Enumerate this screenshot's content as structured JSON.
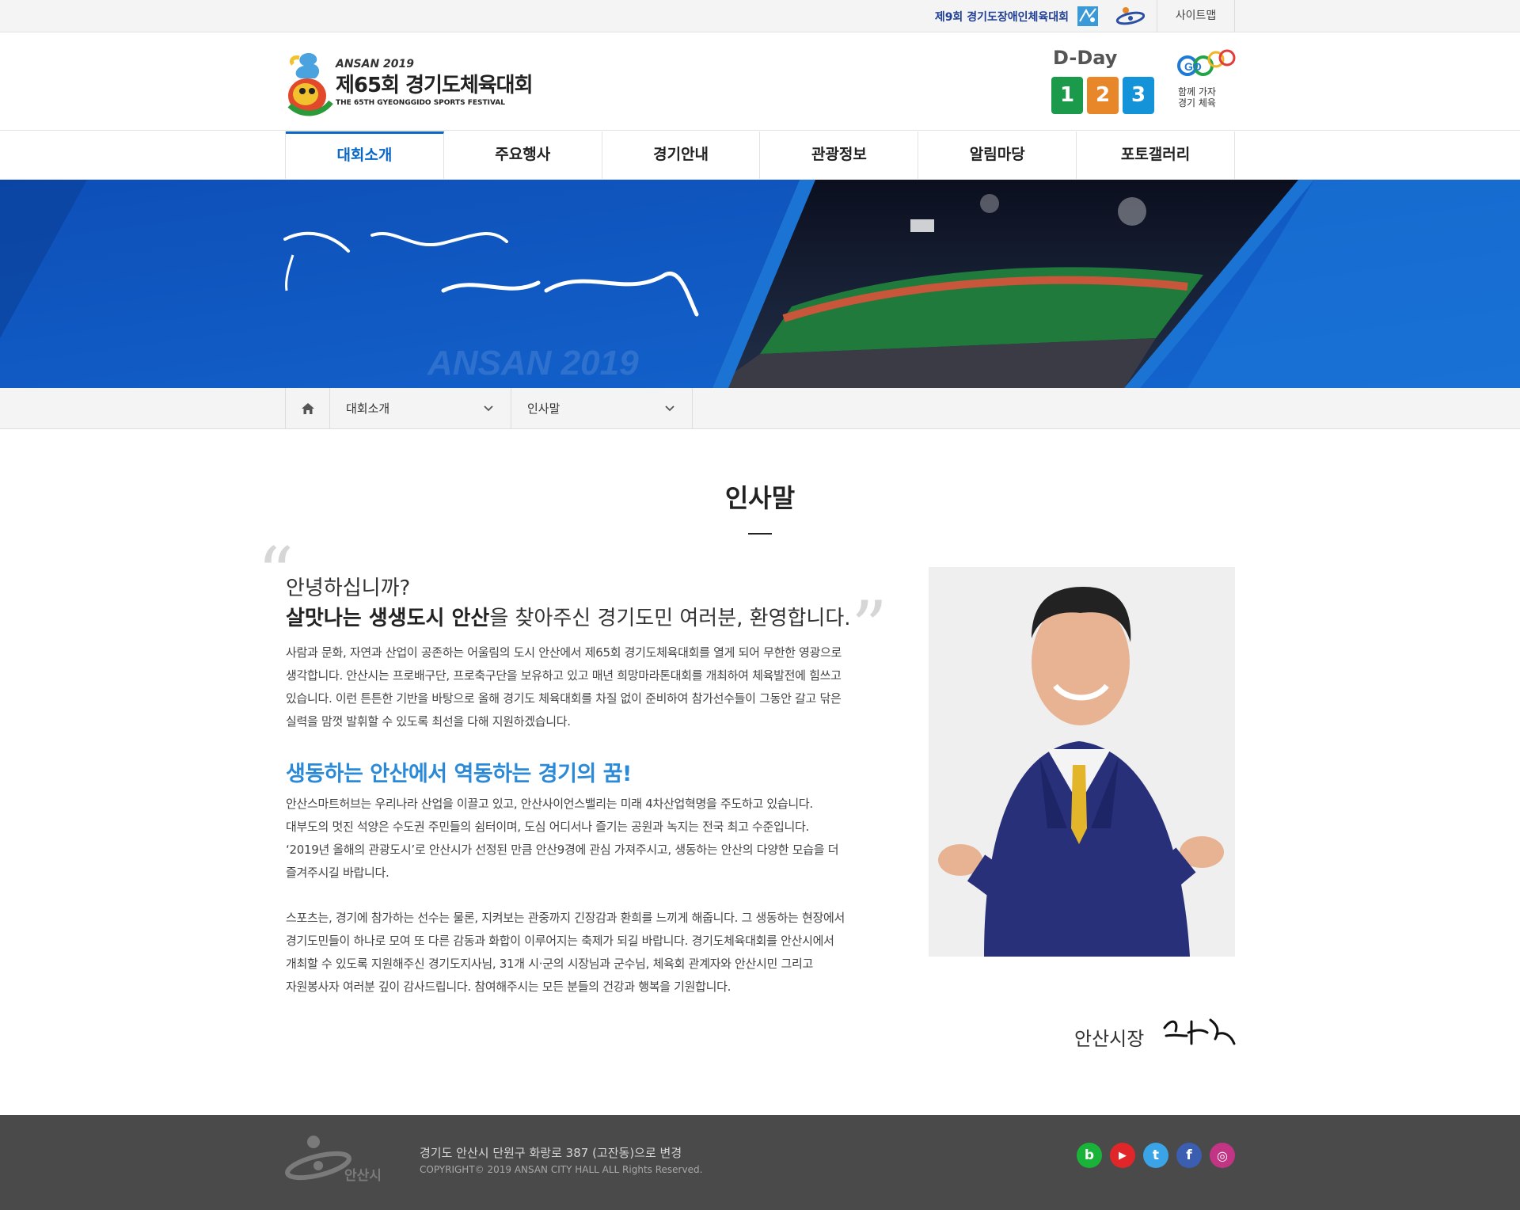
{
  "topbar": {
    "event_link": "제9회 경기도장애인체육대회",
    "sitemap": "사이트맵"
  },
  "header": {
    "logo_top": "ANSAN 2019",
    "logo_main": "제65회 경기도체육대회",
    "logo_sub": "THE 65TH GYEONGGIDO SPORTS FESTIVAL",
    "dday_label": "D-Day",
    "dday_digits": [
      "1",
      "2",
      "3"
    ],
    "dday_colors": [
      "#1c9a4b",
      "#e8872a",
      "#1493d9"
    ],
    "go_mark": "GO",
    "go_text_line1": "함께 가자",
    "go_text_line2": "경기 체육"
  },
  "nav": {
    "items": [
      "대회소개",
      "주요행사",
      "경기안내",
      "관광정보",
      "알림마당",
      "포토갤러리"
    ],
    "active_index": 0
  },
  "banner": {
    "watermark": "ANSAN 2019"
  },
  "breadcrumb": {
    "level1": "대회소개",
    "level2": "인사말"
  },
  "content": {
    "title": "인사말",
    "greeting_line1": "안녕하십니까?",
    "greeting_bold": "살맛나는 생생도시 안산",
    "greeting_rest": "을 찾아주신 경기도민 여러분, 환영합니다.",
    "para1": [
      "사람과 문화, 자연과 산업이 공존하는 어울림의 도시 안산에서 제65회 경기도체육대회를 열게 되어 무한한 영광으로",
      "생각합니다. 안산시는 프로배구단, 프로축구단을 보유하고 있고 매년 희망마라톤대회를 개최하여 체육발전에 힘쓰고",
      "있습니다. 이런 튼튼한 기반을 바탕으로 올해 경기도 체육대회를 차질 없이 준비하여 참가선수들이 그동안 갈고 닦은",
      "실력을 맘껏 발휘할 수 있도록 최선을 다해 지원하겠습니다."
    ],
    "subheading": "생동하는 안산에서 역동하는 경기의 꿈!",
    "para2": [
      "안산스마트허브는 우리나라 산업을 이끌고 있고, 안산사이언스밸리는 미래 4차산업혁명을 주도하고 있습니다.",
      "대부도의 멋진 석양은 수도권 주민들의 쉼터이며, 도심 어디서나 즐기는 공원과 녹지는 전국 최고 수준입니다.",
      "‘2019년 올해의 관광도시’로 안산시가 선정된 만큼 안산9경에 관심 가져주시고, 생동하는 안산의 다양한 모습을 더",
      "즐겨주시길 바랍니다."
    ],
    "para3": [
      "스포츠는, 경기에 참가하는 선수는 물론, 지켜보는 관중까지 긴장감과 환희를 느끼게 해줍니다. 그 생동하는 현장에서",
      "경기도민들이 하나로 모여 또 다른 감동과 화합이 이루어지는 축제가 되길 바랍니다. 경기도체육대회를 안산시에서",
      "개최할 수 있도록 지원해주신 경기도지사님, 31개 시·군의 시장님과 군수님, 체육회 관계자와 안산시민 그리고",
      "자원봉사자 여러분 깊이 감사드립니다. 참여해주시는 모든 분들의 건강과 행복을 기원합니다."
    ],
    "signature_label": "안산시장"
  },
  "footer": {
    "logo_text": "안산시",
    "address": "경기도 안산시 단원구 화랑로 387 (고잔동)으로 변경",
    "copyright": "COPYRIGHT© 2019 ANSAN CITY HALL ALL Rights Reserved.",
    "social": [
      {
        "name": "blog",
        "glyph": "b",
        "color": "#19b33a"
      },
      {
        "name": "youtube",
        "glyph": "▶",
        "color": "#e1262a"
      },
      {
        "name": "twitter",
        "glyph": "t",
        "color": "#3ba4e6"
      },
      {
        "name": "facebook",
        "glyph": "f",
        "color": "#3b5eb0"
      },
      {
        "name": "instagram",
        "glyph": "◎",
        "color": "#c13584"
      }
    ]
  }
}
